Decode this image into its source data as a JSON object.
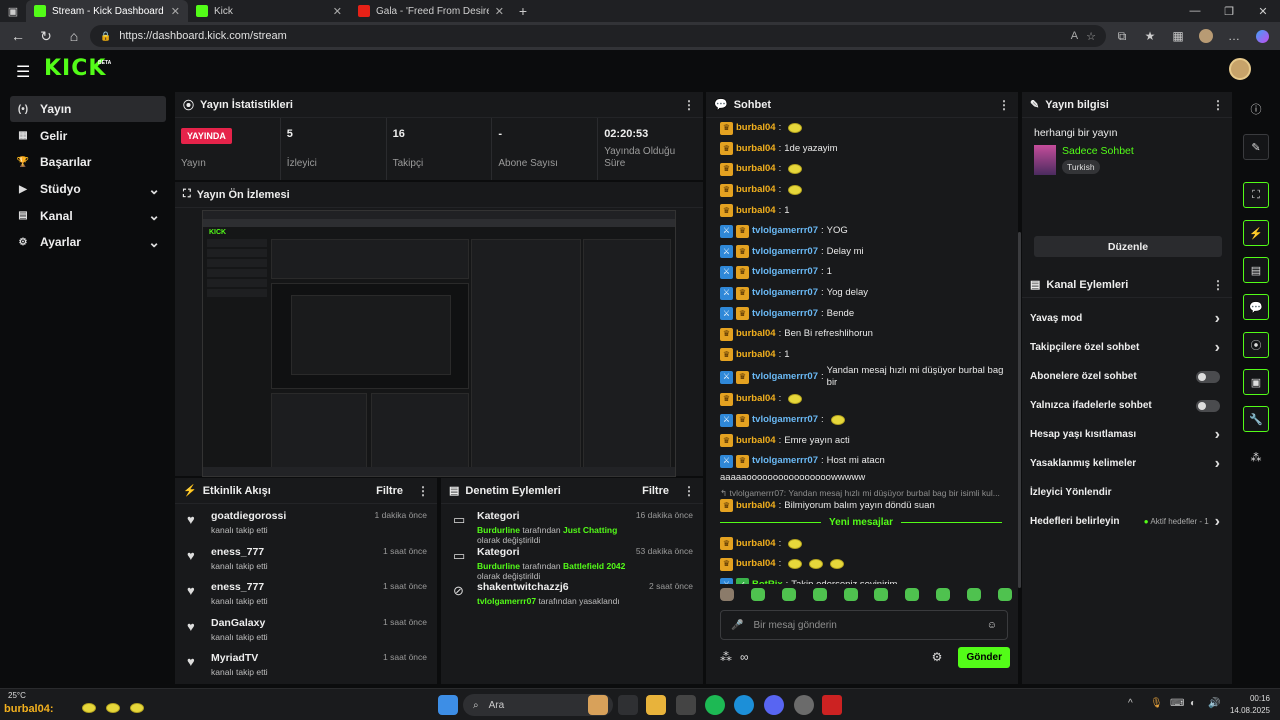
{
  "browser": {
    "tabs": [
      {
        "title": "Stream - Kick Dashboard",
        "favicon_color": "#53fc18",
        "active": true
      },
      {
        "title": "Kick",
        "favicon_color": "#53fc18",
        "active": false
      },
      {
        "title": "Gala - 'Freed From Desire' I Tien G",
        "favicon_color": "#e62117",
        "active": false
      }
    ],
    "url": "https://dashboard.kick.com/stream"
  },
  "app": {
    "logo": "KICK",
    "beta": "BETA"
  },
  "sidebar": {
    "items": [
      {
        "label": "Yayın",
        "icon": "broadcast-icon",
        "glyph": "(•)",
        "active": true,
        "expandable": false
      },
      {
        "label": "Gelir",
        "icon": "revenue-icon",
        "glyph": "▦",
        "active": false,
        "expandable": false
      },
      {
        "label": "Başarılar",
        "icon": "trophy-icon",
        "glyph": "🏆",
        "active": false,
        "expandable": false
      },
      {
        "label": "Stüdyo",
        "icon": "studio-icon",
        "glyph": "▶",
        "active": false,
        "expandable": true
      },
      {
        "label": "Kanal",
        "icon": "channel-icon",
        "glyph": "▤",
        "active": false,
        "expandable": true
      },
      {
        "label": "Ayarlar",
        "icon": "gear-icon",
        "glyph": "⚙",
        "active": false,
        "expandable": true
      }
    ]
  },
  "stats": {
    "title": "Yayın İstatistikleri",
    "items": [
      {
        "value": "YAYINDA",
        "label": "Yayın",
        "is_badge": true
      },
      {
        "value": "5",
        "label": "İzleyici"
      },
      {
        "value": "16",
        "label": "Takipçi"
      },
      {
        "value": "-",
        "label": "Abone Sayısı"
      },
      {
        "value": "02:20:53",
        "label": "Yayında Olduğu Süre"
      }
    ]
  },
  "preview": {
    "title": "Yayın Ön İzlemesi"
  },
  "activity": {
    "title": "Etkinlik Akışı",
    "filter": "Filtre",
    "rows": [
      {
        "name": "goatdiegorossi",
        "sub": "kanalı takip etti",
        "time": "1 dakika önce"
      },
      {
        "name": "eness_777",
        "sub": "kanalı takip etti",
        "time": "1 saat önce"
      },
      {
        "name": "eness_777",
        "sub": "kanalı takip etti",
        "time": "1 saat önce"
      },
      {
        "name": "DanGalaxy",
        "sub": "kanalı takip etti",
        "time": "1 saat önce"
      },
      {
        "name": "MyriadTV",
        "sub": "kanalı takip etti",
        "time": "1 saat önce"
      }
    ]
  },
  "moderation": {
    "title": "Denetim Eylemleri",
    "filter": "Filtre",
    "rows": [
      {
        "name": "Kategori",
        "actor": "Burdurline",
        "mid": "tarafından",
        "target": "Just Chatting",
        "tail": "olarak değiştirildi",
        "time": "16 dakika önce"
      },
      {
        "name": "Kategori",
        "actor": "Burdurline",
        "mid": "tarafından",
        "target": "Battlefield 2042",
        "tail": "olarak değiştirildi",
        "time": "53 dakika önce"
      },
      {
        "name": "shakentwitchazzj6",
        "actor": "tvlolgamerrr07",
        "mid": "tarafından yasaklandı",
        "target": "",
        "tail": "",
        "time": "2 saat önce"
      }
    ]
  },
  "chat": {
    "title": "Sohbet",
    "messages": [
      {
        "user": "burbal04",
        "badge": "gold",
        "color": "u1",
        "text": "",
        "emotes": 1
      },
      {
        "user": "burbal04",
        "badge": "gold",
        "color": "u1",
        "text": "1de yazayim",
        "emotes": 0
      },
      {
        "user": "burbal04",
        "badge": "gold",
        "color": "u1",
        "text": "",
        "emotes": 1
      },
      {
        "user": "burbal04",
        "badge": "gold",
        "color": "u1",
        "text": "",
        "emotes": 1
      },
      {
        "user": "burbal04",
        "badge": "gold",
        "color": "u1",
        "text": "1",
        "emotes": 0
      },
      {
        "user": "tvlolgamerrr07",
        "badge": "blue",
        "color": "u2",
        "text": "YOG",
        "emotes": 0
      },
      {
        "user": "tvlolgamerrr07",
        "badge": "blue",
        "color": "u2",
        "text": "Delay mi",
        "emotes": 0
      },
      {
        "user": "tvlolgamerrr07",
        "badge": "blue",
        "color": "u2",
        "text": "1",
        "emotes": 0
      },
      {
        "user": "tvlolgamerrr07",
        "badge": "blue",
        "color": "u2",
        "text": "Yog delay",
        "emotes": 0
      },
      {
        "user": "tvlolgamerrr07",
        "badge": "blue",
        "color": "u2",
        "text": "Bende",
        "emotes": 0
      },
      {
        "user": "burbal04",
        "badge": "gold",
        "color": "u1",
        "text": "Ben Bi refreshlihorun",
        "emotes": 0
      },
      {
        "user": "burbal04",
        "badge": "gold",
        "color": "u1",
        "text": "1",
        "emotes": 0
      },
      {
        "user": "tvlolgamerrr07",
        "badge": "blue",
        "color": "u2",
        "text": "Yandan mesaj hızlı mi düşüyor burbal bag bir",
        "emotes": 0
      },
      {
        "user": "burbal04",
        "badge": "gold",
        "color": "u1",
        "text": "",
        "emotes": 1
      },
      {
        "user": "tvlolgamerrr07",
        "badge": "blue",
        "color": "u2",
        "text": "",
        "emotes": 1
      },
      {
        "user": "burbal04",
        "badge": "gold",
        "color": "u1",
        "text": "Emre yayın acti",
        "emotes": 0
      },
      {
        "user": "tvlolgamerrr07",
        "badge": "blue",
        "color": "u2",
        "text": "Host mi atacn",
        "emotes": 0
      }
    ],
    "wrap_text": "aaaaaoooooooooooooooowwwww",
    "reply_text": "↰ tvlolgamerrr07: Yandan mesaj hızlı mi düşüyor burbal bag bir isimli kul...",
    "reply_user": "burbal04",
    "reply_msg": "Bilmiyorum balım yayın döndü suan",
    "new_messages": "Yeni mesajlar",
    "after": [
      {
        "user": "burbal04",
        "badge": "gold",
        "color": "u1",
        "text": "",
        "emotes": 1
      },
      {
        "user": "burbal04",
        "badge": "gold",
        "color": "u1",
        "text": "",
        "emotes": 3
      },
      {
        "user": "BotRix",
        "badge": "blue",
        "color": "u3",
        "text": "Takip ederseniz sevinirim.",
        "emotes": 0
      }
    ],
    "input_placeholder": "Bir mesaj gönderin",
    "send_label": "Gönder"
  },
  "info": {
    "title": "Yayın bilgisi",
    "stream_title": "herhangi bir yayın",
    "category": "Sadece Sohbet",
    "tag": "Turkish",
    "edit_label": "Düzenle"
  },
  "channel_actions": {
    "title": "Kanal Eylemleri",
    "rows": [
      {
        "label": "Yavaş mod",
        "kind": "chevron"
      },
      {
        "label": "Takipçilere özel sohbet",
        "kind": "chevron"
      },
      {
        "label": "Abonelere özel sohbet",
        "kind": "toggle"
      },
      {
        "label": "Yalnızca ifadelerle sohbet",
        "kind": "toggle"
      },
      {
        "label": "Hesap yaşı kısıtlaması",
        "kind": "chevron"
      },
      {
        "label": "Yasaklanmış kelimeler",
        "kind": "chevron"
      },
      {
        "label": "İzleyici Yönlendir",
        "kind": "none"
      },
      {
        "label": "Hedefleri belirleyin",
        "kind": "chevron",
        "extra": "Aktif hedefler - 1"
      }
    ]
  },
  "taskbar": {
    "weather": "25°C",
    "ticker": "burbal04:",
    "search": "Ara",
    "time": "00:16",
    "date": "14.08.2025"
  },
  "colors": {
    "accent": "#53fc18",
    "live": "#e6234a"
  }
}
